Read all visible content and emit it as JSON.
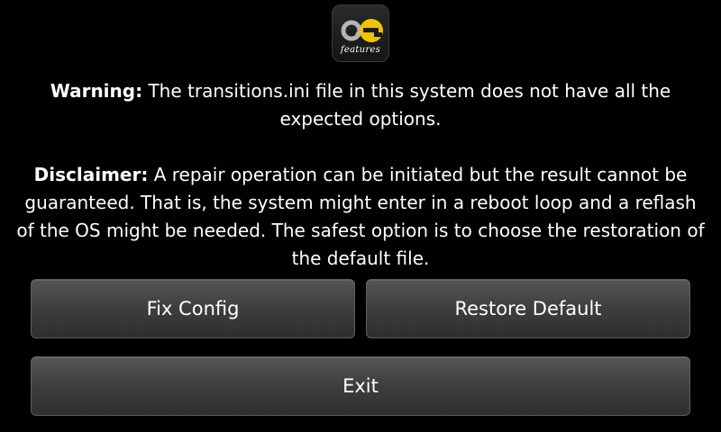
{
  "logo": {
    "icon": "ae-features-logo",
    "caption": "features",
    "accent": "#f2c200"
  },
  "message": {
    "warning_label": "Warning:",
    "warning_text": " The transitions.ini file in this system does not have all the expected options.",
    "disclaimer_label": "Disclaimer:",
    "disclaimer_text": " A repair operation can be initiated but the result cannot be guaranteed. That is, the system might enter in a reboot loop and a reflash of the OS might be needed. The safest option is to choose the restoration of the default file."
  },
  "buttons": {
    "fix_config": "Fix Config",
    "restore_default": "Restore Default",
    "exit": "Exit"
  }
}
